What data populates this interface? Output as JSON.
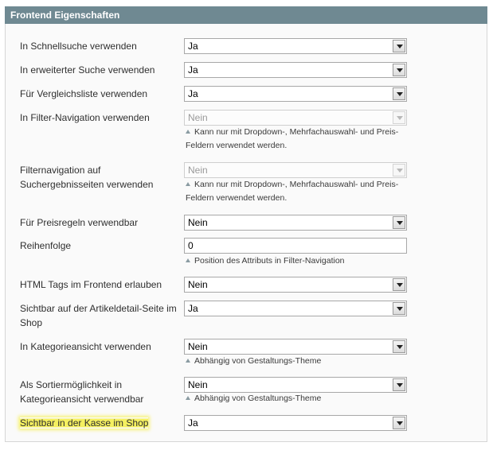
{
  "section": {
    "title": "Frontend Eigenschaften"
  },
  "fields": [
    {
      "label": "In Schnellsuche verwenden",
      "value": "Ja"
    },
    {
      "label": "In erweiterter Suche verwenden",
      "value": "Ja"
    },
    {
      "label": "Für Vergleichsliste verwenden",
      "value": "Ja"
    },
    {
      "label": "In Filter-Navigation verwenden",
      "value": "Nein",
      "note": "Kann nur mit Dropdown-, Mehrfachauswahl- und Preis-Feldern verwendet werden."
    },
    {
      "label": "Filternavigation auf Suchergebnisseiten verwenden",
      "value": "Nein",
      "note": "Kann nur mit Dropdown-, Mehrfachauswahl- und Preis-Feldern verwendet werden."
    },
    {
      "label": "Für Preisregeln verwendbar",
      "value": "Nein"
    },
    {
      "label": "Reihenfolge",
      "value": "0",
      "note": "Position des Attributs in Filter-Navigation"
    },
    {
      "label": "HTML Tags im Frontend erlauben",
      "value": "Nein"
    },
    {
      "label": "Sichtbar auf der Artikeldetail-Seite im Shop",
      "value": "Ja"
    },
    {
      "label": "In Kategorieansicht verwenden",
      "value": "Nein",
      "note": "Abhängig von Gestaltungs-Theme"
    },
    {
      "label": "Als Sortiermöglichkeit in Kategorieansicht verwendbar",
      "value": "Nein",
      "note": "Abhängig von Gestaltungs-Theme"
    },
    {
      "label": "Sichtbar in der Kasse im Shop",
      "value": "Ja"
    }
  ],
  "colors": {
    "header": "#6f8992",
    "highlight": "#f5f060"
  }
}
